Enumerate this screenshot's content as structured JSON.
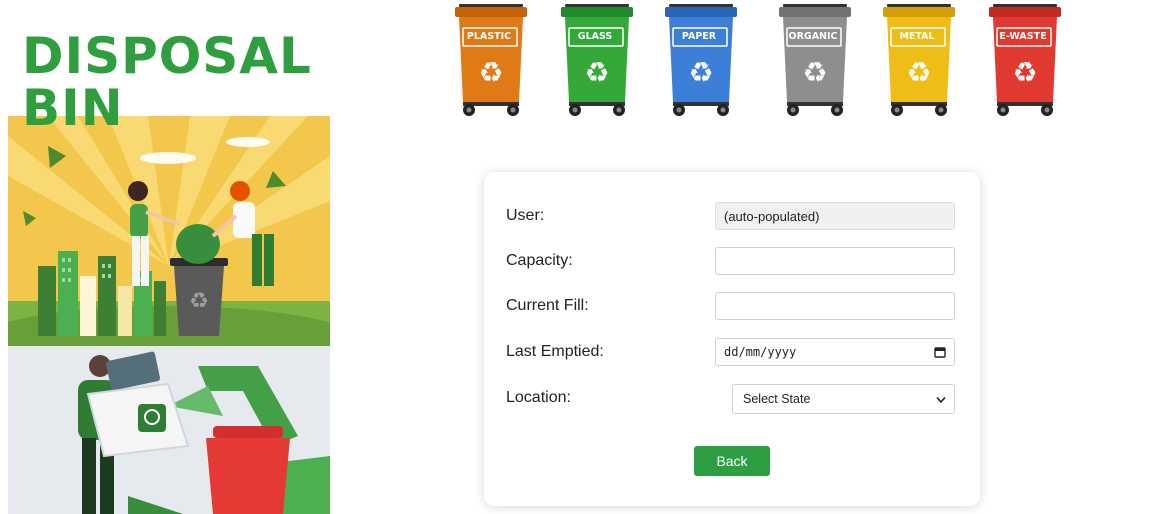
{
  "poster": {
    "title": "DISPOSAL\nBIN"
  },
  "bins": [
    {
      "label": "PLASTIC",
      "color": "#e07a16",
      "lid": "#c4630a"
    },
    {
      "label": "GLASS",
      "color": "#35a83a",
      "lid": "#238a2b"
    },
    {
      "label": "PAPER",
      "color": "#3b7fd8",
      "lid": "#2a66b8"
    },
    {
      "label": "ORGANIC",
      "color": "#8e8e8e",
      "lid": "#727272"
    },
    {
      "label": "METAL",
      "color": "#f0bc16",
      "lid": "#d59f08"
    },
    {
      "label": "E-WASTE",
      "color": "#e03a30",
      "lid": "#c12a22"
    }
  ],
  "form": {
    "user_label": "User:",
    "user_value": "(auto-populated)",
    "capacity_label": "Capacity:",
    "capacity_value": "",
    "current_fill_label": "Current Fill:",
    "current_fill_value": "",
    "last_emptied_label": "Last Emptied:",
    "last_emptied_placeholder": "dd/mm/yyyy",
    "location_label": "Location:",
    "location_selected": "Select State",
    "back_label": "Back"
  },
  "colors": {
    "accent_green": "#2e9e43",
    "title_green": "#2f9e3f"
  }
}
